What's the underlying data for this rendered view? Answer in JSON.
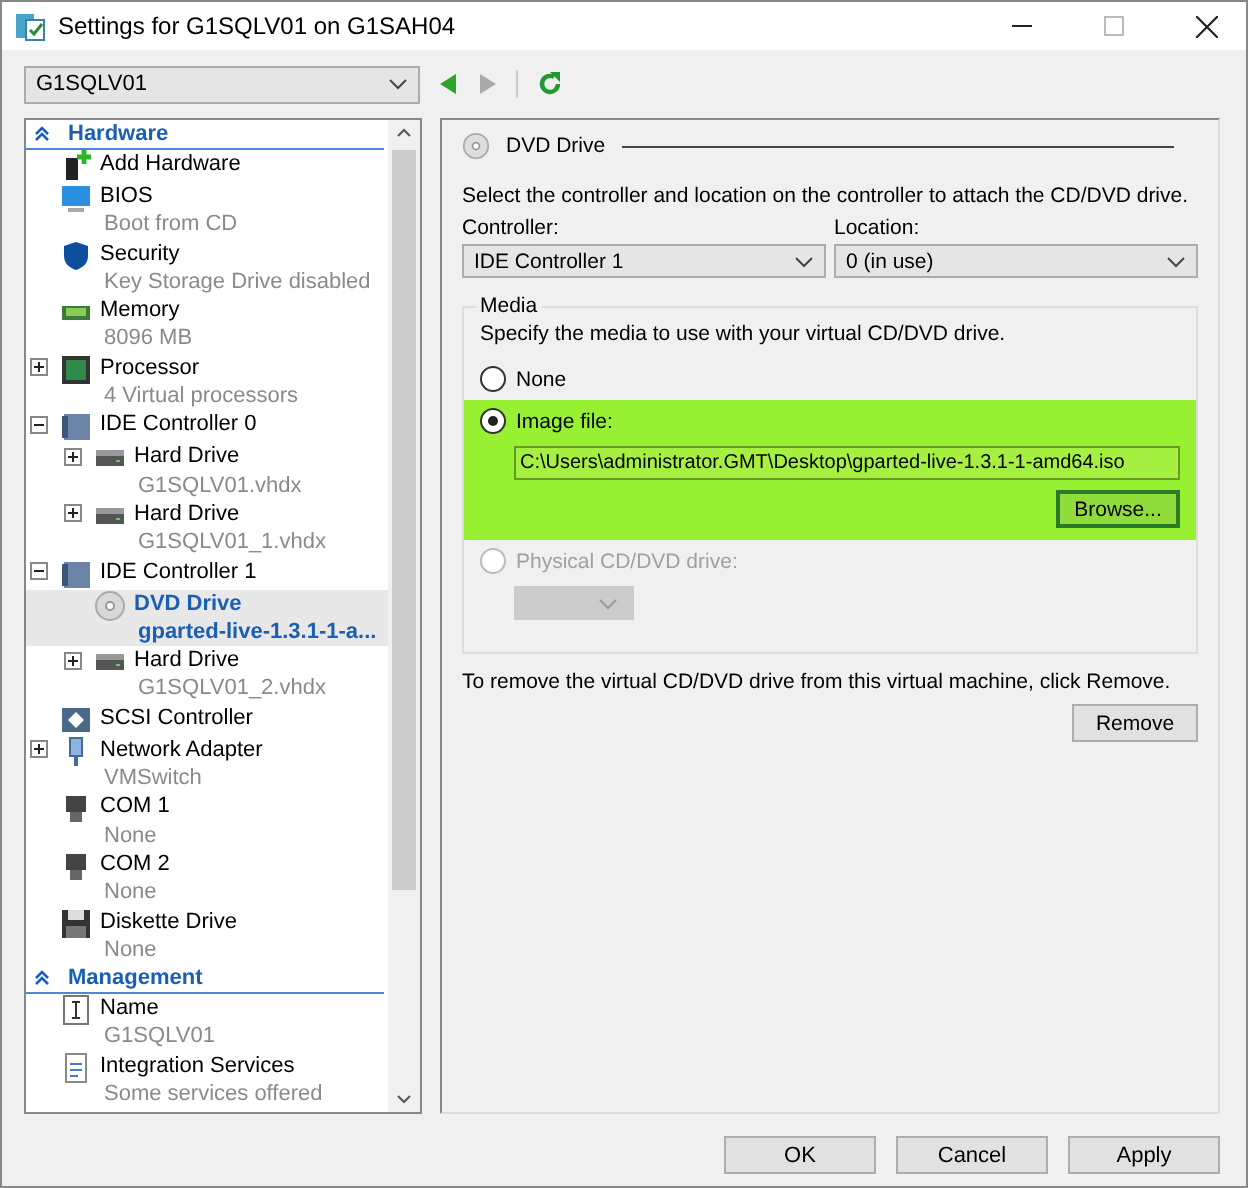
{
  "window": {
    "title": "Settings for G1SQLV01 on G1SAH04"
  },
  "vm_selector": {
    "value": "G1SQLV01"
  },
  "sidebar": {
    "sections": [
      {
        "title": "Hardware",
        "items": [
          {
            "kind": "add",
            "label": "Add Hardware",
            "selected": false
          },
          {
            "kind": "bios",
            "label": "BIOS",
            "sub": "Boot from CD",
            "selected": false
          },
          {
            "kind": "shield",
            "label": "Security",
            "sub": "Key Storage Drive disabled",
            "selected": false
          },
          {
            "kind": "memory",
            "label": "Memory",
            "sub": "8096 MB",
            "selected": false
          },
          {
            "kind": "chip",
            "label": "Processor",
            "sub": "4 Virtual processors",
            "selected": false,
            "expanded": false
          },
          {
            "kind": "controller",
            "label": "IDE Controller 0",
            "selected": false,
            "expanded": true,
            "children": [
              {
                "kind": "disk",
                "label": "Hard Drive",
                "sub": "G1SQLV01.vhdx",
                "selected": false,
                "expanded": false
              },
              {
                "kind": "disk",
                "label": "Hard Drive",
                "sub": "G1SQLV01_1.vhdx",
                "selected": false,
                "expanded": false
              }
            ]
          },
          {
            "kind": "controller",
            "label": "IDE Controller 1",
            "selected": false,
            "expanded": true,
            "children": [
              {
                "kind": "dvd",
                "label": "DVD Drive",
                "sub": "gparted-live-1.3.1-1-a...",
                "selected": true
              },
              {
                "kind": "disk",
                "label": "Hard Drive",
                "sub": "G1SQLV01_2.vhdx",
                "selected": false,
                "expanded": false
              }
            ]
          },
          {
            "kind": "scsi",
            "label": "SCSI Controller",
            "selected": false
          },
          {
            "kind": "network",
            "label": "Network Adapter",
            "sub": "VMSwitch",
            "selected": false,
            "expanded": false
          },
          {
            "kind": "port",
            "label": "COM 1",
            "sub": "None",
            "selected": false
          },
          {
            "kind": "port",
            "label": "COM 2",
            "sub": "None",
            "selected": false
          },
          {
            "kind": "floppy",
            "label": "Diskette Drive",
            "sub": "None",
            "selected": false
          }
        ]
      },
      {
        "title": "Management",
        "items": [
          {
            "kind": "name",
            "label": "Name",
            "sub": "G1SQLV01",
            "selected": false
          },
          {
            "kind": "services",
            "label": "Integration Services",
            "sub": "Some services offered",
            "selected": false
          }
        ]
      }
    ]
  },
  "panel": {
    "title": "DVD Drive",
    "intro": "Select the controller and location on the controller to attach the CD/DVD drive.",
    "controller": {
      "label": "Controller:",
      "value": "IDE Controller 1"
    },
    "location": {
      "label": "Location:",
      "value": "0 (in use)"
    },
    "media": {
      "title": "Media",
      "description": "Specify the media to use with your virtual CD/DVD drive.",
      "options": [
        {
          "kind": "plain",
          "label": "None",
          "selected": false,
          "disabled": false,
          "highlighted": false
        },
        {
          "kind": "file",
          "label": "Image file:",
          "selected": true,
          "disabled": false,
          "highlighted": true,
          "value": "C:\\Users\\administrator.GMT\\Desktop\\gparted-live-1.3.1-1-amd64.iso",
          "button": "Browse..."
        },
        {
          "kind": "physical",
          "label": "Physical CD/DVD drive:",
          "selected": false,
          "disabled": true,
          "highlighted": false
        }
      ]
    },
    "remove_note": "To remove the virtual CD/DVD drive from this virtual machine, click Remove.",
    "remove_button": "Remove"
  },
  "buttons": [
    "OK",
    "Cancel",
    "Apply"
  ]
}
